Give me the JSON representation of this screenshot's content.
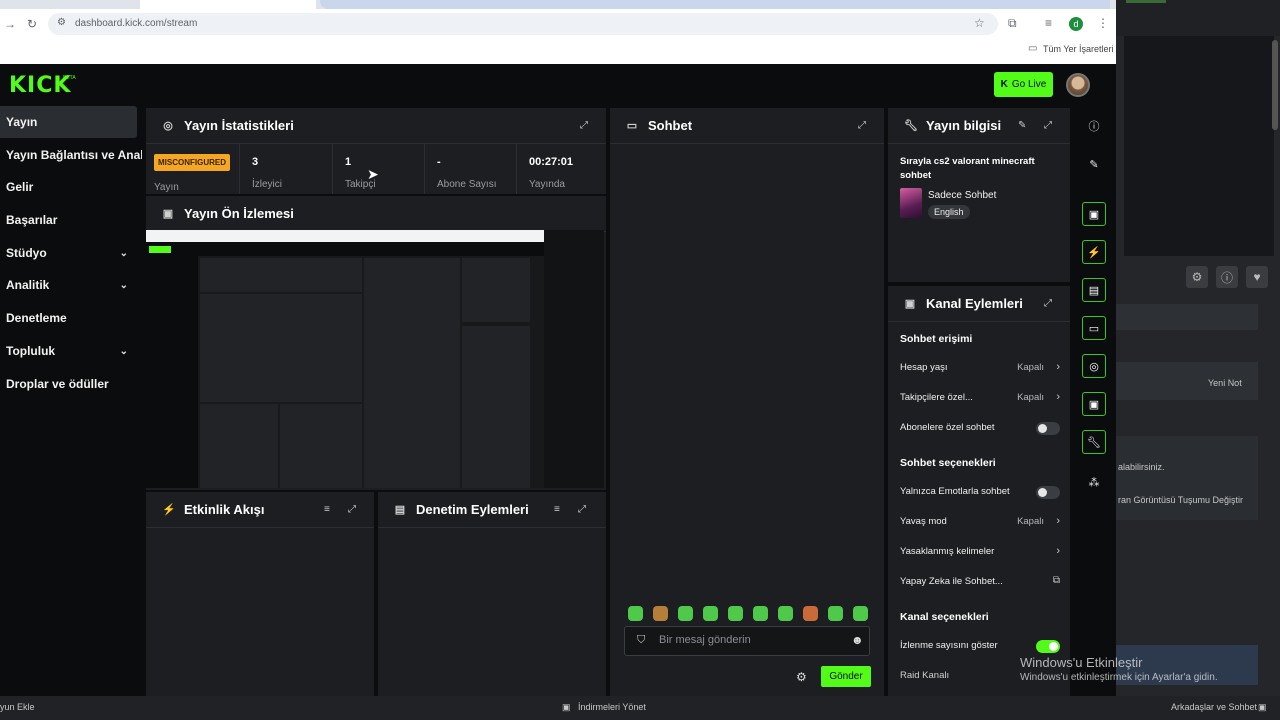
{
  "browser": {
    "url": "dashboard.kick.com/stream",
    "bookmarks_label": "Tüm Yer İşaretleri",
    "profile_initial": "d"
  },
  "header": {
    "logo": "KICK",
    "logo_sup": "BETA",
    "go_live": "Go Live"
  },
  "sidebar": {
    "items": [
      {
        "label": "Yayın"
      },
      {
        "label": "Yayın Bağlantısı ve Anahtar"
      },
      {
        "label": "Gelir"
      },
      {
        "label": "Başarılar"
      },
      {
        "label": "Stüdyo"
      },
      {
        "label": "Analitik"
      },
      {
        "label": "Denetleme"
      },
      {
        "label": "Topluluk"
      },
      {
        "label": "Droplar ve ödüller"
      }
    ]
  },
  "stats_panel": {
    "title": "Yayın İstatistikleri",
    "badge": "MISCONFIGURED",
    "stats": [
      {
        "value": "",
        "label": "Yayın"
      },
      {
        "value": "3",
        "label": "İzleyici"
      },
      {
        "value": "1",
        "label": "Takipçi"
      },
      {
        "value": "-",
        "label": "Abone Sayısı"
      },
      {
        "value": "00:27:01",
        "label": "Yayında"
      }
    ]
  },
  "preview_panel": {
    "title": "Yayın Ön İzlemesi"
  },
  "activity_panel": {
    "title": "Etkinlik Akışı"
  },
  "moderation_panel": {
    "title": "Denetim Eylemleri"
  },
  "chat_panel": {
    "title": "Sohbet",
    "placeholder": "Bir mesaj gönderin",
    "send": "Gönder"
  },
  "info_panel": {
    "title": "Yayın bilgisi",
    "stream_title": "Sırayla cs2 valorant minecraft sohbet",
    "category": "Sadece Sohbet",
    "language": "English"
  },
  "actions_panel": {
    "title": "Kanal Eylemleri",
    "chat_access": "Sohbet erişimi",
    "account_age": {
      "label": "Hesap yaşı",
      "value": "Kapalı"
    },
    "followers_only": {
      "label": "Takipçilere özel...",
      "value": "Kapalı"
    },
    "subs_only": {
      "label": "Abonelere özel sohbet"
    },
    "chat_options": "Sohbet seçenekleri",
    "emotes_only": {
      "label": "Yalnızca Emotlarla sohbet"
    },
    "slow_mode": {
      "label": "Yavaş mod",
      "value": "Kapalı"
    },
    "banned_words": {
      "label": "Yasaklanmış kelimeler"
    },
    "ai_chat": {
      "label": "Yapay Zeka ile Sohbet..."
    },
    "channel_options": "Kanal seçenekleri",
    "show_viewers": {
      "label": "İzlenme sayısını göster"
    },
    "raid": {
      "label": "Raid Kanalı"
    }
  },
  "watermark": {
    "line1": "Windows'u Etkinleştir",
    "line2": "Windows'u etkinleştirmek için Ayarlar'a gidin."
  },
  "taskbar": {
    "left": "yun Ekle",
    "center": "İndirmeleri Yönet",
    "right": "Arkadaşlar ve Sohbet"
  },
  "bg_window": {
    "not_label": "Yeni Not",
    "text1": "alabilirsiniz.",
    "text2": "ran Görüntüsü Tuşumu Değiştir"
  },
  "colors": {
    "brand": "#53fc18",
    "badge": "#f5a623",
    "panel": "#1c1e21",
    "background": "#0b0c0d"
  }
}
